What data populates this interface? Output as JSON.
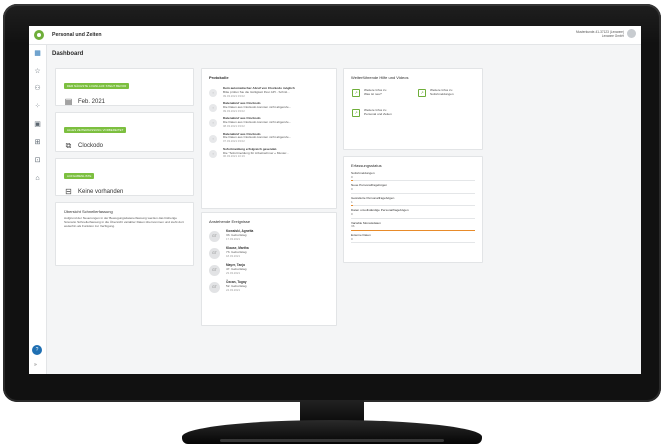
{
  "app": {
    "title": "Personal und Zeiten"
  },
  "user": {
    "line1": "Musterkunde-41-37123 (Lexware)",
    "line2": "Lexware GmbH"
  },
  "page": {
    "title": "Dashboard"
  },
  "kpis": [
    {
      "badge": "DER NÄCHSTE LOHNLAUF STEHT BEVOR",
      "value": "Feb. 2021",
      "icon": "calendar-icon"
    },
    {
      "badge": "ALLES ZEITERFASSUNG VORBEREITET",
      "value": "Clockodo",
      "icon": "external-link-icon"
    },
    {
      "badge": "AUFGABENLISTE",
      "value": "Keine vorhanden",
      "icon": "note-icon"
    }
  ],
  "info_card": {
    "title": "Übersicht Schnellerfassung",
    "text": "Aufgrund der Neuerungen in der Bewegungsdatenerfassung werden das bisherige Szenario Schnellerfassung in die Übersicht variabler Daten übernommen und steht dort weiterhin als Funktion zur Verfügung."
  },
  "protokolle": {
    "title": "Protokolle",
    "items": [
      {
        "title": "Kein automatischer Abruf von Clockodo möglich",
        "desc": "Bitte prüfen Sie die Gültigkeit Ihrer API - Schnit...",
        "date": "09.03.2021 03:02"
      },
      {
        "title": "Datenabruf aus Clockodo",
        "desc": "Die Daten aus Clockodo konnten nicht abgerufe...",
        "date": "09.03.2021 03:02"
      },
      {
        "title": "Datenabruf aus Clockodo",
        "desc": "Die Daten aus Clockodo konnten nicht abgerufe...",
        "date": "08.03.2021 03:02"
      },
      {
        "title": "Datenabruf aus Clockodo",
        "desc": "Die Daten aus Clockodo konnten nicht abgerufe...",
        "date": "07.03.2021 03:02"
      },
      {
        "title": "Sofortmeldung erfolgreich gesendet.",
        "desc": "Die \"Sofortmeldung für Arbeitnehmer « Muster...",
        "date": "06.03.2021 10:19"
      }
    ]
  },
  "ereignisse": {
    "title": "Anstehende Ereignisse",
    "items": [
      {
        "initials": "GT",
        "name": "Kowalski, Agnetta",
        "sub": "33. Geburtstag",
        "date": "17.03.2021"
      },
      {
        "initials": "GT",
        "name": "Klause, Martha",
        "sub": "73. Geburtstag",
        "date": "18.03.2021"
      },
      {
        "initials": "GT",
        "name": "Mayer, Tanja",
        "sub": "47. Geburtstag",
        "date": "23.03.2021"
      },
      {
        "initials": "GT",
        "name": "Özcan, Tugay",
        "sub": "52. Geburtstag",
        "date": "24.03.2021"
      }
    ]
  },
  "hilfe": {
    "title": "Weiterführende Hilfe und Videos",
    "links": [
      {
        "line1": "Weitere Infos zu",
        "line2": "Was ist neu?"
      },
      {
        "line1": "Weitere Infos zu",
        "line2": "Sofortmeldungen"
      },
      {
        "line1": "Weitere Infos zu",
        "line2": "Personal und Zeiten"
      }
    ]
  },
  "erfassung": {
    "title": "Erfassungsstatus",
    "items": [
      {
        "label": "Sofortmeldungen",
        "value": "0",
        "fill": 0.02
      },
      {
        "label": "Neue Personalfragebögen",
        "value": "0",
        "fill": 0
      },
      {
        "label": "Geänderte Personalfragebögen",
        "value": "1",
        "fill": 0.02
      },
      {
        "label": "Daten unvollständige Personalfragebögen",
        "value": "0",
        "fill": 0
      },
      {
        "label": "Variable Monatsdaten",
        "value": "36",
        "fill": 1.0
      },
      {
        "label": "Externe Daten",
        "value": "0",
        "fill": 0
      }
    ]
  },
  "colors": {
    "accent": "#1f6fb2",
    "brand_green": "#7cbf3f",
    "progress": "#e88b2a"
  }
}
